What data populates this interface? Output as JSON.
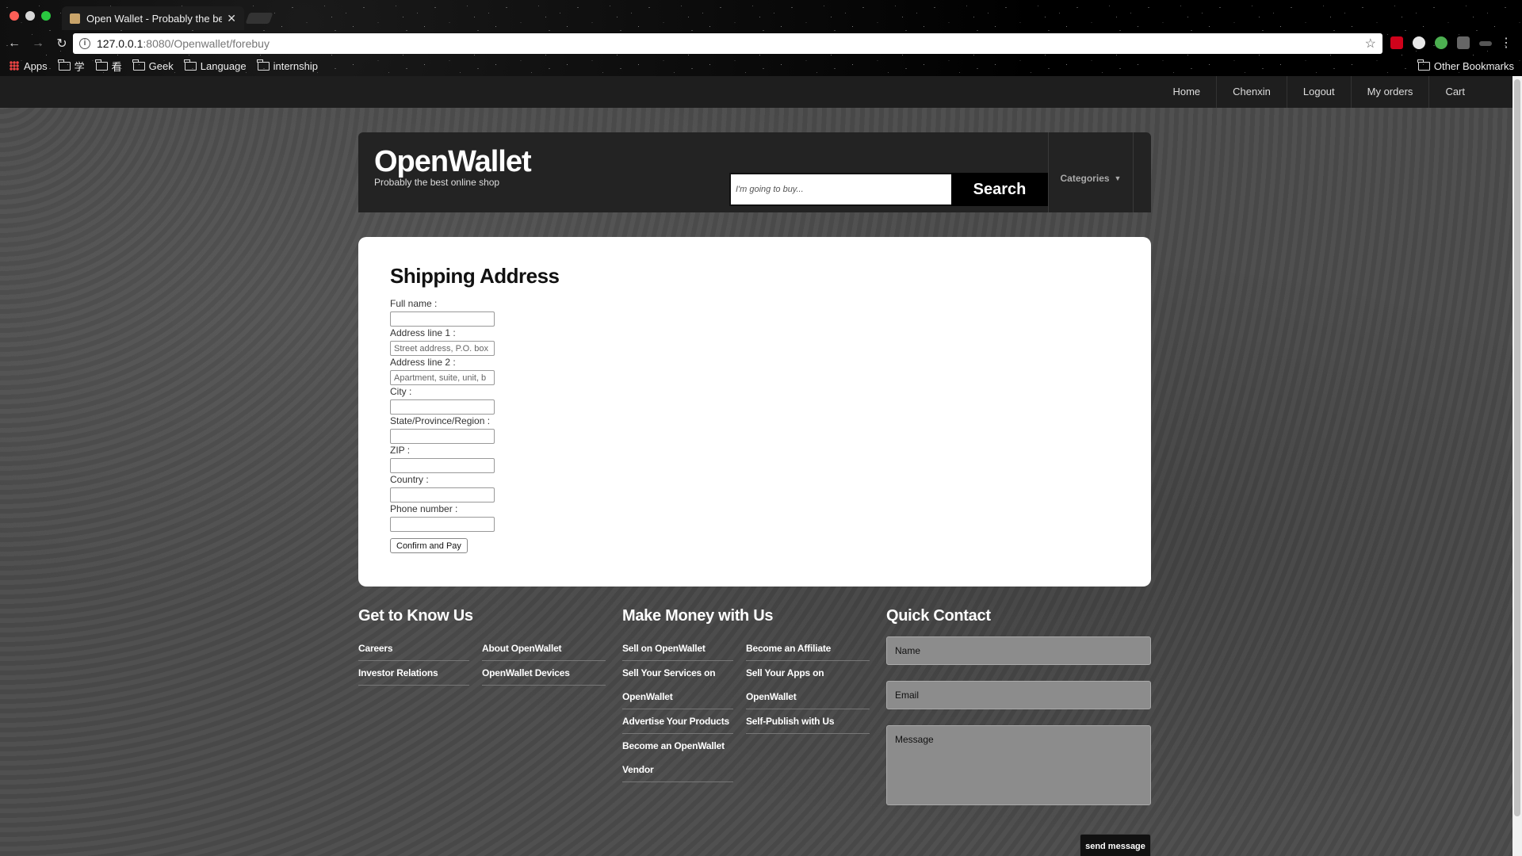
{
  "browser": {
    "tab_title": "Open Wallet - Probably the be",
    "url_host": "127.0.0.1",
    "url_path": ":8080/Openwallet/forebuy",
    "bookmarks": [
      "Apps",
      "学",
      "看",
      "Geek",
      "Language",
      "internship"
    ],
    "other_bookmarks": "Other Bookmarks"
  },
  "topnav": [
    "Home",
    "Chenxin",
    "Logout",
    "My orders",
    "Cart"
  ],
  "header": {
    "logo": "OpenWallet",
    "tagline": "Probably the best online shop",
    "search_placeholder": "I'm going to buy...",
    "search_button": "Search",
    "categories": "Categories"
  },
  "form": {
    "title": "Shipping Address",
    "fields": [
      {
        "label": "Full name :",
        "placeholder": ""
      },
      {
        "label": "Address line 1 :",
        "placeholder": "Street address, P.O. box"
      },
      {
        "label": "Address line 2 :",
        "placeholder": "Apartment, suite, unit, b"
      },
      {
        "label": "City :",
        "placeholder": ""
      },
      {
        "label": "State/Province/Region :",
        "placeholder": ""
      },
      {
        "label": "ZIP :",
        "placeholder": ""
      },
      {
        "label": "Country :",
        "placeholder": ""
      },
      {
        "label": "Phone number :",
        "placeholder": ""
      }
    ],
    "submit": "Confirm and Pay"
  },
  "footer": {
    "know": {
      "title": "Get to Know Us",
      "col1": [
        "Careers",
        "Investor Relations"
      ],
      "col2": [
        "About OpenWallet",
        "OpenWallet Devices"
      ]
    },
    "money": {
      "title": "Make Money with Us",
      "col1": [
        "Sell on OpenWallet",
        "Sell Your Services on OpenWallet",
        "Advertise Your Products",
        "Become an OpenWallet Vendor"
      ],
      "col2": [
        "Become an Affiliate",
        "Sell Your Apps on OpenWallet",
        "Self-Publish with Us"
      ]
    },
    "contact": {
      "title": "Quick Contact",
      "name_placeholder": "Name",
      "email_placeholder": "Email",
      "message_placeholder": "Message",
      "send": "send message"
    }
  }
}
